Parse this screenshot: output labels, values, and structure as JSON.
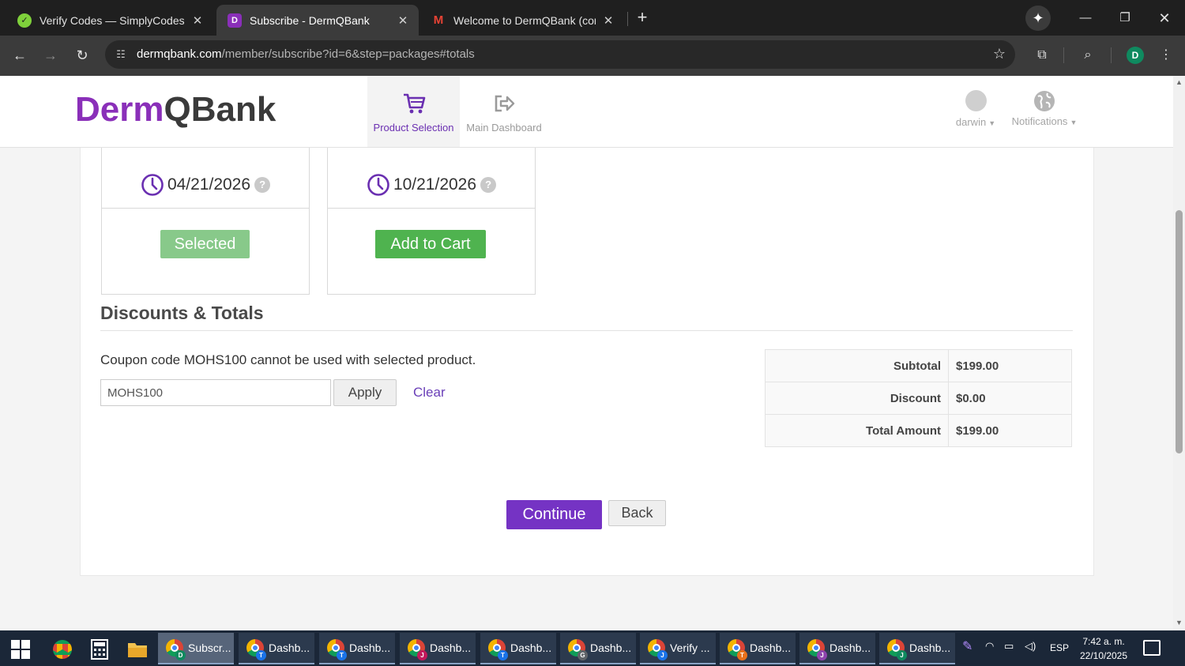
{
  "browser": {
    "tabs": [
      {
        "title": "Verify Codes — SimplyCodes",
        "icon": "simplycodes-icon",
        "active": false
      },
      {
        "title": "Subscribe - DermQBank",
        "icon": "dermqbank-icon",
        "active": true
      },
      {
        "title": "Welcome to DermQBank (confi",
        "icon": "gmail-icon",
        "active": false
      }
    ],
    "url_host": "dermqbank.com",
    "url_path": "/member/subscribe?id=6&step=packages#totals",
    "profile_initial": "D"
  },
  "header": {
    "logo_part1": "Derm",
    "logo_part2": "QBank",
    "nav": [
      {
        "label": "Product Selection",
        "icon": "cart-icon",
        "active": true
      },
      {
        "label": "Main Dashboard",
        "icon": "sign-out-icon",
        "active": false
      }
    ],
    "user_label": "darwin",
    "notifications_label": "Notifications"
  },
  "packages": [
    {
      "expiry": "04/21/2026",
      "button_label": "Selected",
      "state": "selected"
    },
    {
      "expiry": "10/21/2026",
      "button_label": "Add to Cart",
      "state": "available"
    }
  ],
  "discounts": {
    "title": "Discounts & Totals",
    "coupon_message": "Coupon code MOHS100 cannot be used with selected product.",
    "coupon_value": "MOHS100",
    "apply_label": "Apply",
    "clear_label": "Clear",
    "totals": [
      {
        "label": "Subtotal",
        "value": "$199.00"
      },
      {
        "label": "Discount",
        "value": "$0.00"
      },
      {
        "label": "Total Amount",
        "value": "$199.00"
      }
    ]
  },
  "actions": {
    "continue_label": "Continue",
    "back_label": "Back"
  },
  "taskbar": {
    "tasks": [
      {
        "label": "Subscr...",
        "badge": "D",
        "badge_color": "#0f8a5f",
        "active": true
      },
      {
        "label": "Dashb...",
        "badge": "T",
        "badge_color": "#1a73e8",
        "active": false
      },
      {
        "label": "Dashb...",
        "badge": "T",
        "badge_color": "#1a73e8",
        "active": false
      },
      {
        "label": "Dashb...",
        "badge": "J",
        "badge_color": "#c2185b",
        "active": false
      },
      {
        "label": "Dashb...",
        "badge": "T",
        "badge_color": "#1a73e8",
        "active": false
      },
      {
        "label": "Dashb...",
        "badge": "G",
        "badge_color": "#5f6368",
        "active": false
      },
      {
        "label": "Verify ...",
        "badge": "J",
        "badge_color": "#1a73e8",
        "active": false
      },
      {
        "label": "Dashb...",
        "badge": "T",
        "badge_color": "#e8711a",
        "active": false
      },
      {
        "label": "Dashb...",
        "badge": "J",
        "badge_color": "#8e44ad",
        "active": false
      },
      {
        "label": "Dashb...",
        "badge": "J",
        "badge_color": "#0f8a5f",
        "active": false
      }
    ],
    "language": "ESP",
    "time": "7:42 a. m.",
    "date": "22/10/2025"
  },
  "colors": {
    "brand_purple": "#7533c4",
    "success_green": "#4fb34f",
    "selected_green": "#88c98a"
  }
}
